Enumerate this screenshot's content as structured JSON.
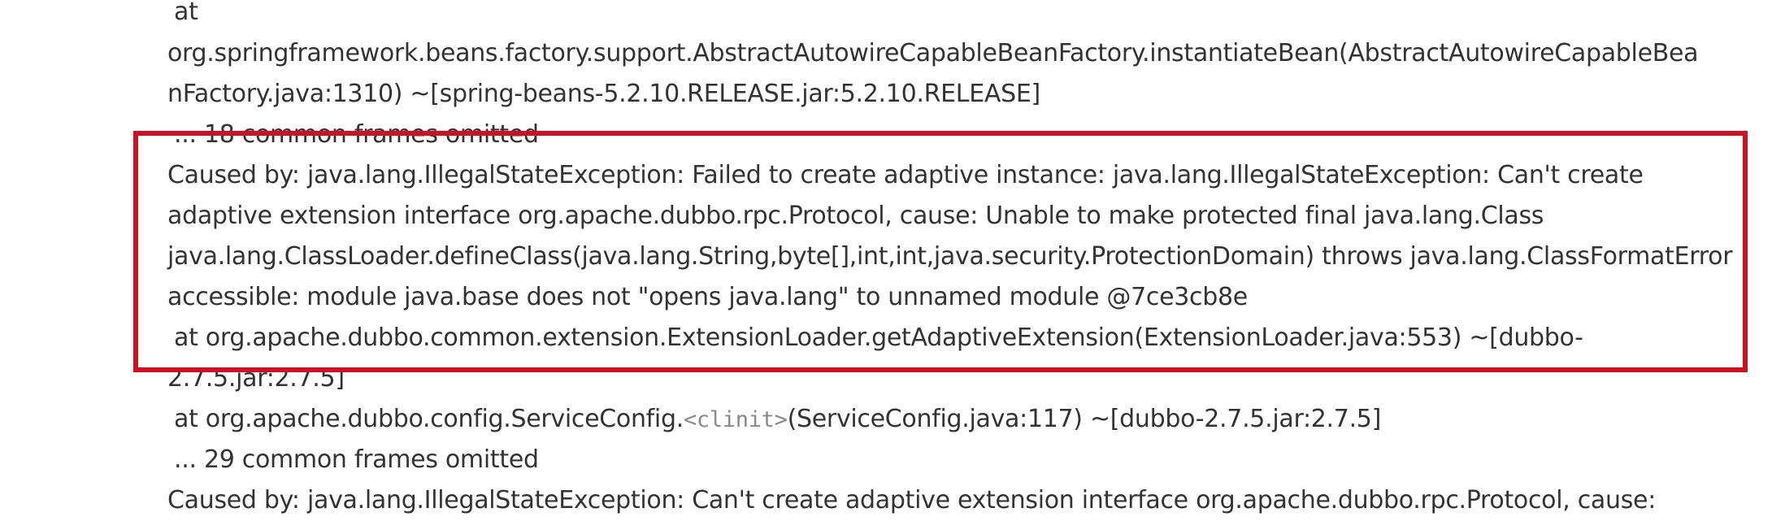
{
  "log": {
    "lines": [
      "at",
      "org.springframework.beans.factory.support.AbstractAutowireCapableBeanFactory.instantiateBean(AbstractAutowireCapableBea",
      "nFactory.java:1310) ~[spring-beans-5.2.10.RELEASE.jar:5.2.10.RELEASE]",
      "... 18 common frames omitted",
      "Caused by: java.lang.IllegalStateException: Failed to create adaptive instance: java.lang.IllegalStateException: Can't create",
      "adaptive extension interface org.apache.dubbo.rpc.Protocol, cause: Unable to make protected final java.lang.Class",
      "java.lang.ClassLoader.defineClass(java.lang.String,byte[],int,int,java.security.ProtectionDomain) throws java.lang.ClassFormatError",
      "accessible: module java.base does not \"opens java.lang\" to unnamed module @7ce3cb8e",
      "at org.apache.dubbo.common.extension.ExtensionLoader.getAdaptiveExtension(ExtensionLoader.java:553) ~[dubbo-",
      "2.7.5.jar:2.7.5]",
      "at org.apache.dubbo.config.ServiceConfig.",
      "<clinit>",
      "(ServiceConfig.java:117) ~[dubbo-2.7.5.jar:2.7.5]",
      "... 29 common frames omitted",
      "Caused by: java.lang.IllegalStateException: Can't create adaptive extension interface org.apache.dubbo.rpc.Protocol, cause:"
    ]
  },
  "highlight": {
    "color": "#cc1222"
  }
}
